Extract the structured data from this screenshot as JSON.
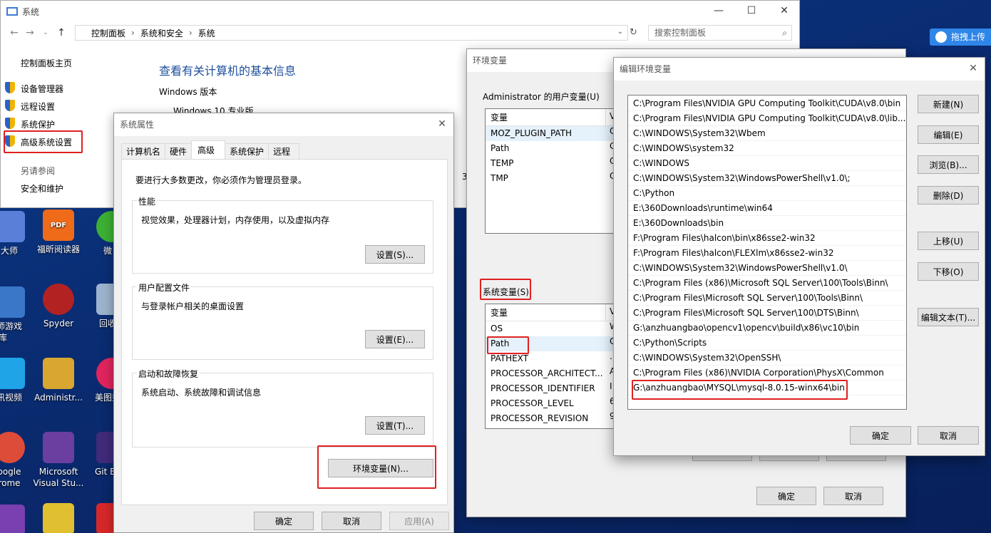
{
  "desktop": {
    "icons": [
      {
        "label_top": "大师",
        "color": "#5a7fd8"
      },
      {
        "label_top": "福昕阅读器",
        "color": "#ef6b1a"
      },
      {
        "label_top": "微",
        "color": "#3cb034"
      },
      {
        "label_top": "师游戏",
        "label_bottom": "库",
        "color": "#3a77c8"
      },
      {
        "label_top": "Spyder",
        "color": "#b22222"
      },
      {
        "label_top": "回收",
        "color": "#9bb3cc"
      },
      {
        "label_top": "讯视频",
        "color": "#1fa4e8"
      },
      {
        "label_top": "Administr...",
        "color": "#d9a72f"
      },
      {
        "label_top": "美图秀",
        "color": "#e0245e"
      },
      {
        "label_top": "oogle",
        "label_bottom": "rome",
        "color": "#dd4b39"
      },
      {
        "label_top": "Microsoft",
        "label_bottom": "Visual Stu...",
        "color": "#6a3fa0"
      },
      {
        "label_top": "Git Ba",
        "color": "#402a7a"
      },
      {
        "label_top": "",
        "color": "#7a3fb0"
      },
      {
        "label_top": "",
        "color": "#e0c030"
      },
      {
        "label_top": "",
        "color": "#d62828"
      }
    ],
    "upload_label": "拖拽上传"
  },
  "sys_window": {
    "title": "系统",
    "breadcrumb": [
      "控制面板",
      "系统和安全",
      "系统"
    ],
    "search_placeholder": "搜索控制面板",
    "side": {
      "home": "控制面板主页",
      "device_manager": "设备管理器",
      "remote": "远程设置",
      "protection": "系统保护",
      "advanced": "高级系统设置",
      "see_also": "另请参阅",
      "security": "安全和维护"
    },
    "heading": "查看有关计算机的基本信息",
    "windows_version_label": "Windows 版本",
    "windows_edition": "Windows 10 专业版",
    "partial_3": "3"
  },
  "sysprop": {
    "title": "系统属性",
    "tabs": [
      "计算机名",
      "硬件",
      "高级",
      "系统保护",
      "远程"
    ],
    "active_tab": "高级",
    "admin_note": "要进行大多数更改，你必须作为管理员登录。",
    "perf_title": "性能",
    "perf_desc": "视觉效果，处理器计划，内存使用，以及虚拟内存",
    "perf_btn": "设置(S)...",
    "profile_title": "用户配置文件",
    "profile_desc": "与登录帐户相关的桌面设置",
    "profile_btn": "设置(E)...",
    "startup_title": "启动和故障恢复",
    "startup_desc": "系统启动、系统故障和调试信息",
    "startup_btn": "设置(T)...",
    "env_btn": "环境变量(N)...",
    "ok": "确定",
    "cancel": "取消",
    "apply": "应用(A)"
  },
  "envvar": {
    "title": "环境变量",
    "user_group": "Administrator 的用户变量(U)",
    "user_header": "变量",
    "user_rows": [
      "MOZ_PLUGIN_PATH",
      "Path",
      "TEMP",
      "TMP"
    ],
    "user_col2_partial": [
      "C",
      "C",
      "C",
      "C"
    ],
    "sys_group": "系统变量(S)",
    "sys_header": "变量",
    "sys_rows": [
      "OS",
      "Path",
      "PATHEXT",
      "PROCESSOR_ARCHITECT...",
      "PROCESSOR_IDENTIFIER",
      "PROCESSOR_LEVEL",
      "PROCESSOR_REVISION"
    ],
    "sys_col2_partial": [
      "W",
      "C",
      ".",
      "A",
      "I",
      "6",
      "9"
    ],
    "ok": "确定",
    "cancel": "取消"
  },
  "editenv": {
    "title": "编辑环境变量",
    "paths": [
      "C:\\Program Files\\NVIDIA GPU Computing Toolkit\\CUDA\\v8.0\\bin",
      "C:\\Program Files\\NVIDIA GPU Computing Toolkit\\CUDA\\v8.0\\lib...",
      "C:\\WINDOWS\\System32\\Wbem",
      "C:\\WINDOWS\\system32",
      "C:\\WINDOWS",
      "C:\\WINDOWS\\System32\\WindowsPowerShell\\v1.0\\;",
      "C:\\Python",
      "E:\\360Downloads\\runtime\\win64",
      "E:\\360Downloads\\bin",
      "F:\\Program Files\\halcon\\bin\\x86sse2-win32",
      "F:\\Program Files\\halcon\\FLEXlm\\x86sse2-win32",
      "C:\\WINDOWS\\System32\\WindowsPowerShell\\v1.0\\",
      "C:\\Program Files (x86)\\Microsoft SQL Server\\100\\Tools\\Binn\\",
      "C:\\Program Files\\Microsoft SQL Server\\100\\Tools\\Binn\\",
      "C:\\Program Files\\Microsoft SQL Server\\100\\DTS\\Binn\\",
      "G:\\anzhuangbao\\opencv1\\opencv\\build\\x86\\vc10\\bin",
      "C:\\Python\\Scripts",
      "C:\\WINDOWS\\System32\\OpenSSH\\",
      "C:\\Program Files (x86)\\NVIDIA Corporation\\PhysX\\Common",
      "G:\\anzhuangbao\\MYSQL\\mysql-8.0.15-winx64\\bin"
    ],
    "buttons": [
      "新建(N)",
      "编辑(E)",
      "浏览(B)...",
      "删除(D)",
      "上移(U)",
      "下移(O)",
      "编辑文本(T)..."
    ],
    "ok": "确定",
    "cancel": "取消"
  },
  "colors": {
    "highlight_red": "#e02020",
    "link_blue": "#1e5fa8",
    "heading_blue": "#1e4f9c"
  }
}
